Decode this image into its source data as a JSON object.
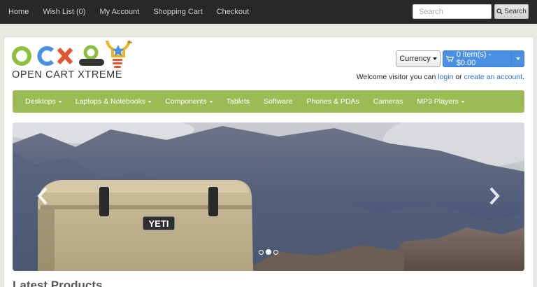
{
  "topnav": {
    "items": [
      {
        "label": "Home"
      },
      {
        "label": "Wish List (0)"
      },
      {
        "label": "My Account"
      },
      {
        "label": "Shopping Cart"
      },
      {
        "label": "Checkout"
      }
    ]
  },
  "search": {
    "placeholder": "Search",
    "button_label": "Search",
    "icon": "magnifier-icon"
  },
  "logo": {
    "text": "OPEN CART XTREME",
    "mark": "OCXO",
    "trademark": "™",
    "colors": {
      "o": "#8bbf3f",
      "c": "#4a90e2",
      "x": "#e5542d",
      "o2": "#333333",
      "bulb": "#f2b21b",
      "star": "#4a90e2"
    }
  },
  "header": {
    "currency_label": "Currency",
    "cart_label": "0 item(s) - $0.00",
    "cart_icon": "shopping-cart-icon",
    "welcome_prefix": "Welcome visitor you can",
    "login_link": "login",
    "or_text": "or",
    "create_account_link": "create an account",
    "welcome_suffix": "."
  },
  "menu": {
    "color": "#9bbb55",
    "items": [
      {
        "label": "Desktops",
        "dropdown": true
      },
      {
        "label": "Laptops & Notebooks",
        "dropdown": true
      },
      {
        "label": "Components",
        "dropdown": true
      },
      {
        "label": "Tablets",
        "dropdown": false
      },
      {
        "label": "Software",
        "dropdown": false
      },
      {
        "label": "Phones & PDAs",
        "dropdown": false
      },
      {
        "label": "Cameras",
        "dropdown": false
      },
      {
        "label": "MP3 Players",
        "dropdown": true
      }
    ]
  },
  "slider": {
    "brand_text": "YETI",
    "dots": 3,
    "active_dot": 2
  },
  "section": {
    "latest_products": "Latest Products"
  }
}
